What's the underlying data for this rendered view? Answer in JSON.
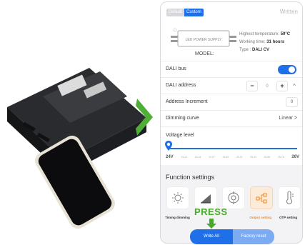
{
  "header": {
    "mode_tabs": [
      "Default",
      "Custom"
    ],
    "status": "Written"
  },
  "device": {
    "label": "LED POWER SUPPLY",
    "model_label": "MODEL:",
    "specs": {
      "temp_label": "Highest temperature:",
      "temp_value": "59°C",
      "time_label": "Working time:",
      "time_value": "31 hours",
      "type_label": "Type :",
      "type_value": "DALI CV"
    }
  },
  "settings": {
    "dali_bus": {
      "label": "DALI bus",
      "enabled": true
    },
    "dali_address": {
      "label": "DALI address",
      "value": "0",
      "minus": "−",
      "plus": "+"
    },
    "address_increment": {
      "label": "Address Increment",
      "value": "0"
    },
    "dimming_curve": {
      "label": "Dimming curve",
      "value": "Linear >"
    },
    "voltage": {
      "label": "Voltage level",
      "ticks": [
        "24V",
        "24.22",
        "24.44",
        "24.67",
        "24.89",
        "25.11",
        "25.33",
        "25.56",
        "25.78",
        "26V"
      ],
      "selected": "24V"
    }
  },
  "function_settings": {
    "title": "Function settings",
    "items": [
      {
        "label": "Timing dimming",
        "icon": "sun-timer-icon"
      },
      {
        "label": "",
        "icon": "dimming-ramp-icon"
      },
      {
        "label": "",
        "icon": "target-icon"
      },
      {
        "label": "Output setting",
        "icon": "output-node-icon"
      },
      {
        "label": "OTP setting",
        "icon": "thermometer-icon"
      }
    ],
    "active_index": 3
  },
  "overlay": {
    "press": "PRESS"
  },
  "actions": {
    "write_all": "Write All",
    "factory_reset": "Factory reset"
  },
  "colors": {
    "accent": "#1f6fe8",
    "active_orange": "#f08a24",
    "press_green": "#4aa82c"
  }
}
